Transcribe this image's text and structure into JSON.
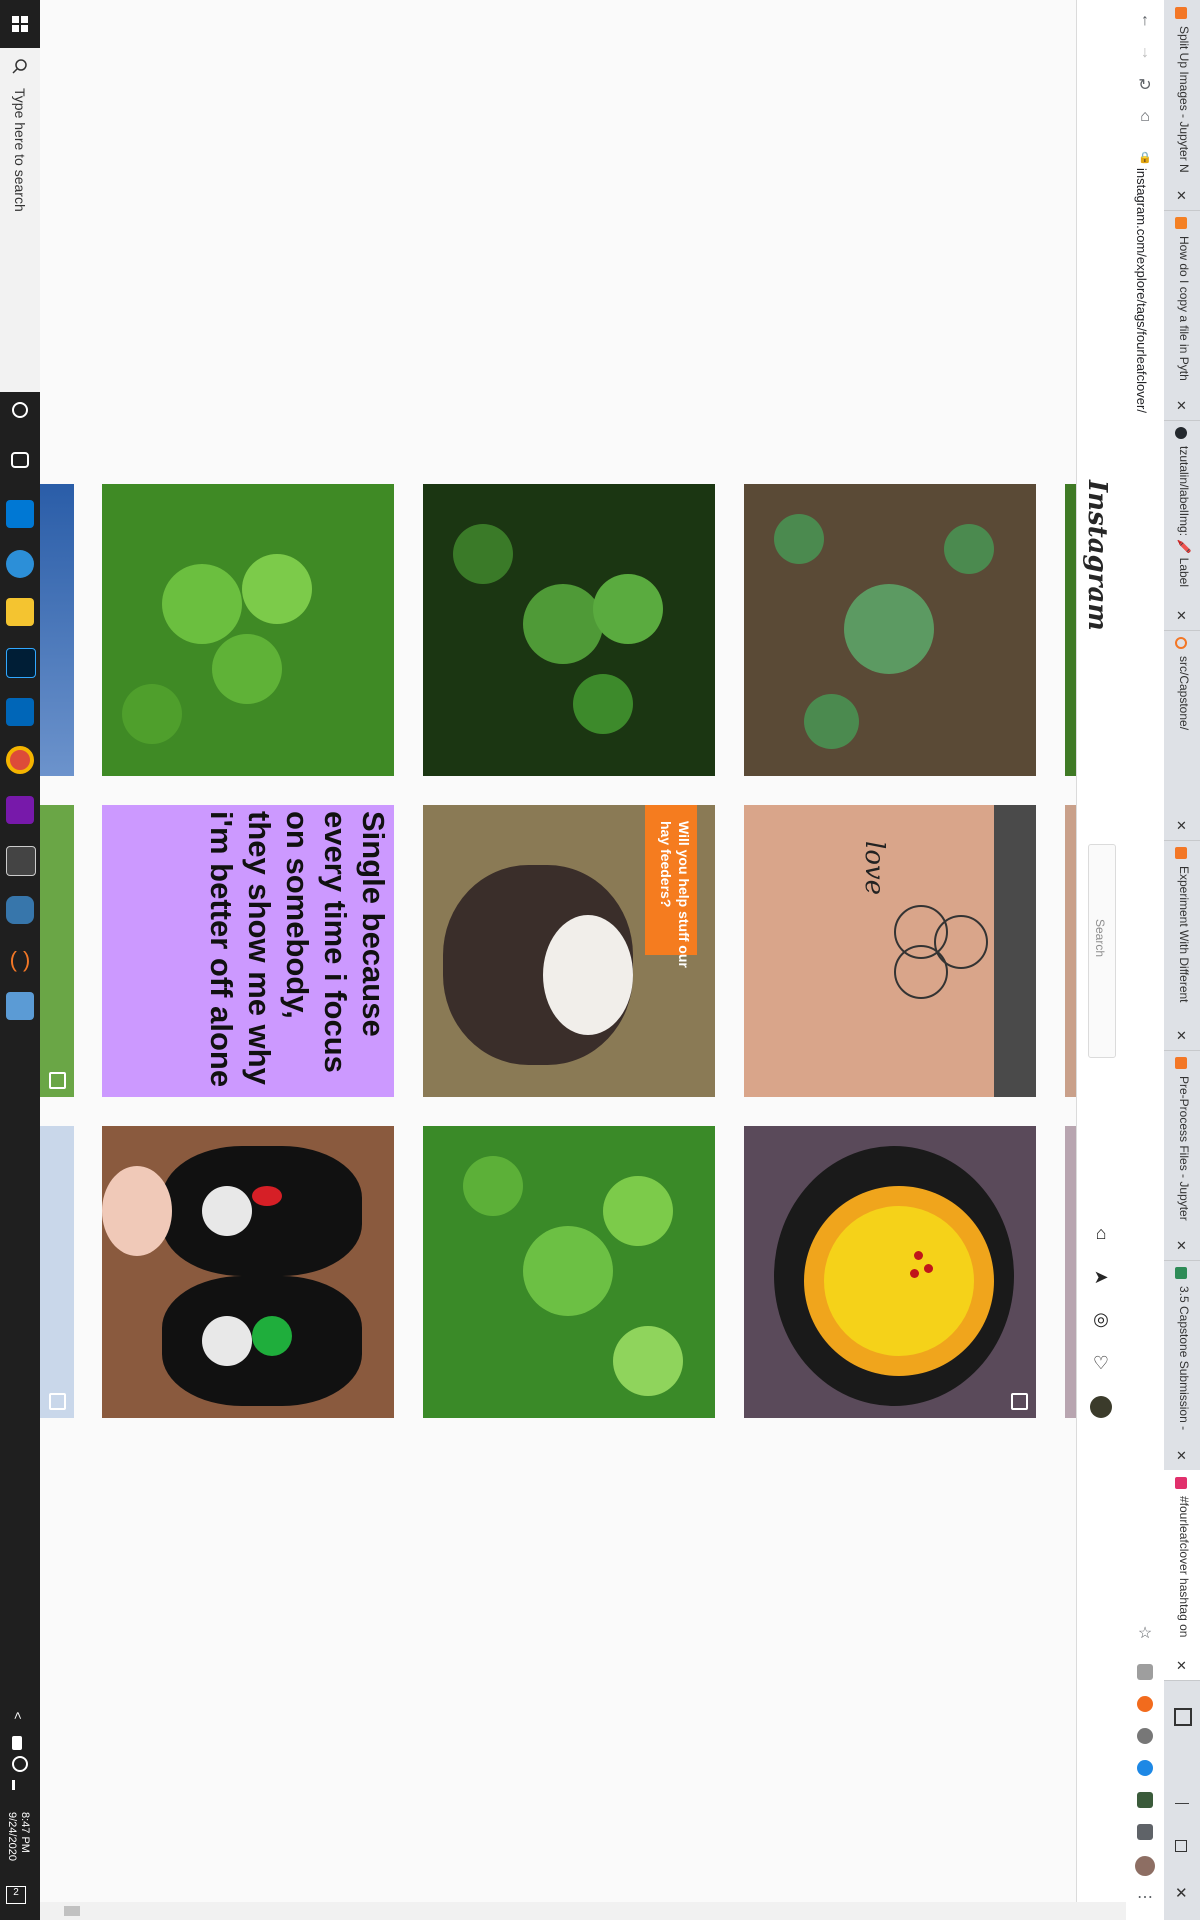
{
  "taskbar": {
    "search_placeholder": "Type here to search",
    "time": "8:47 PM",
    "date": "9/24/2020",
    "notification_count": "2"
  },
  "browser": {
    "tabs": [
      {
        "title": "Split Up Images - Jupyter N",
        "favicon_color": "#f37726"
      },
      {
        "title": "How do I copy a file in Pyth",
        "favicon_color": "#f48024"
      },
      {
        "title": "tzutalin/labelImg: 🖍️ Label",
        "favicon_color": "#24292e"
      },
      {
        "title": "src/Capstone/",
        "favicon_color": "#f37726"
      },
      {
        "title": "Experiment With Different",
        "favicon_color": "#f37726"
      },
      {
        "title": "Pre-Process Files - Jupyter",
        "favicon_color": "#f37726"
      },
      {
        "title": "3.5 Capstone Submission -",
        "favicon_color": "#2e8b57"
      },
      {
        "title": "#fourleafclover hashtag on",
        "favicon_color": "#e1306c"
      }
    ],
    "url": "instagram.com/explore/tags/fourleafclover/"
  },
  "instagram": {
    "logo": "Instagram",
    "search_placeholder": "Search"
  },
  "posts": {
    "p4": {
      "text": "Single because every time i focus on somebody, they show me why i'm better off alone"
    },
    "p5": {
      "text": "Will you help stuff our hay feeders?"
    },
    "p6": {
      "tattoo_text": "love"
    }
  },
  "colors": {
    "tab_bg": "#dee1e6",
    "ig_border": "#dbdbdb",
    "purple_post": "#cc99ff",
    "orange_banner": "#f57c1f"
  }
}
